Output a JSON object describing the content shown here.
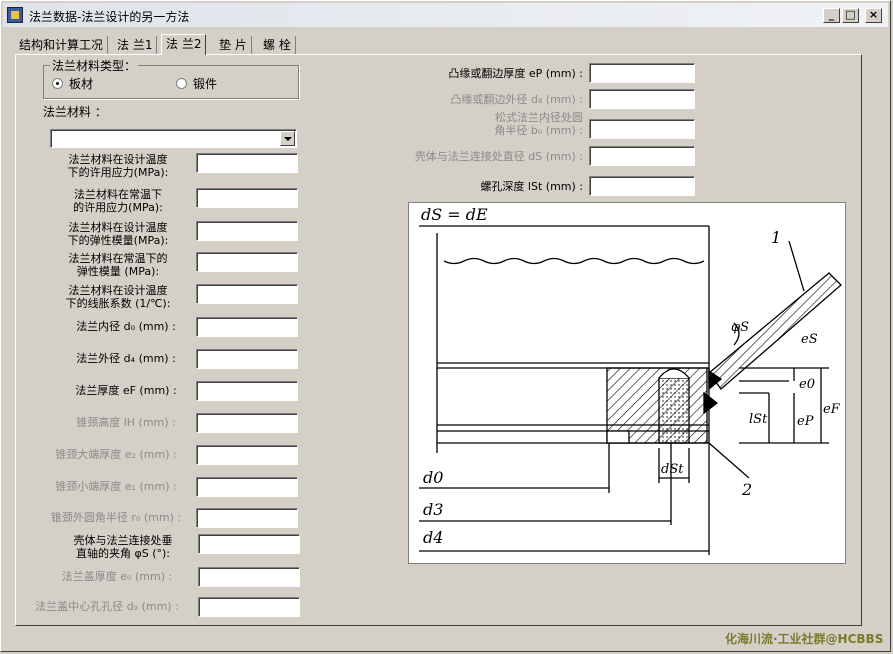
{
  "window": {
    "title": "法兰数据-法兰设计的另一方法",
    "minimize": "_",
    "maximize": "□",
    "close": "×"
  },
  "tabs": [
    "结构和计算工况",
    "法 兰1",
    "法 兰2",
    "垫 片",
    "螺 栓"
  ],
  "active_tab": 2,
  "material_type": {
    "title": "法兰材料类型：",
    "options": [
      "板材",
      "锻件"
    ],
    "selected": 0
  },
  "material": {
    "label": "法兰材料 ：",
    "value": ""
  },
  "left_fields": [
    {
      "l1": "法兰材料在设计温度",
      "l2": "下的许用应力(MPa):",
      "value": "",
      "disabled": false
    },
    {
      "l1": "法兰材料在常温下",
      "l2": "的许用应力(MPa):",
      "value": "",
      "disabled": false
    },
    {
      "l1": "法兰材料在设计温度",
      "l2": "下的弹性模量(MPa):",
      "value": "",
      "disabled": false
    },
    {
      "l1": "法兰材料在常温下的",
      "l2": "弹性模量 (MPa):",
      "value": "",
      "disabled": false
    },
    {
      "l1": "法兰材料在设计温度",
      "l2": "下的线胀系数 (1/℃):",
      "value": "",
      "disabled": false
    },
    {
      "l1": "法兰内径 d₀ (mm) :",
      "l2": "",
      "value": "",
      "disabled": false
    },
    {
      "l1": "法兰外径 d₄ (mm) :",
      "l2": "",
      "value": "",
      "disabled": false
    },
    {
      "l1": "法兰厚度 eF (mm) :",
      "l2": "",
      "value": "",
      "disabled": false
    },
    {
      "l1": "锥颈高度 lH (mm) :",
      "l2": "",
      "value": "",
      "disabled": true
    },
    {
      "l1": "锥颈大端厚度 e₂ (mm) :",
      "l2": "",
      "value": "",
      "disabled": true
    },
    {
      "l1": "锥颈小端厚度 e₁ (mm) :",
      "l2": "",
      "value": "",
      "disabled": true
    },
    {
      "l1": "锥颈外圆角半径 r₀ (mm) :",
      "l2": "",
      "value": "",
      "disabled": true
    },
    {
      "l1": "壳体与法兰连接处垂",
      "l2": "直轴的夹角 φS (°):",
      "value": "",
      "disabled": false
    },
    {
      "l1": "法兰盖厚度 e₀ (mm) :",
      "l2": "",
      "value": "",
      "disabled": true
    },
    {
      "l1": "法兰盖中心孔孔径 d₉ (mm) :",
      "l2": "",
      "value": "",
      "disabled": true
    }
  ],
  "right_fields": [
    {
      "l1": "凸缘或翻边厚度 eP (mm) :",
      "l2": "",
      "value": "",
      "disabled": false
    },
    {
      "l1": "凸缘或翻边外径 d₈ (mm) :",
      "l2": "",
      "value": "",
      "disabled": true
    },
    {
      "l1": "松式法兰内径处圆",
      "l2": "角半径 b₀ (mm) :",
      "value": "",
      "disabled": true
    },
    {
      "l1": "壳体与法兰连接处直径 dS (mm) :",
      "l2": "",
      "value": "",
      "disabled": true
    },
    {
      "l1": "螺孔深度 lSt (mm) :",
      "l2": "",
      "value": "",
      "disabled": false
    }
  ],
  "diagram_labels": {
    "top": "dS = dE",
    "one": "1",
    "two": "2",
    "phi": "φS",
    "es": "eS",
    "e0": "e0",
    "ep": "eP",
    "ef": "eF",
    "lst": "lSt",
    "dst": "dSt",
    "d0": "d0",
    "d3": "d3",
    "d4": "d4"
  },
  "watermark": "化海川流·工业社群@HCBBS"
}
